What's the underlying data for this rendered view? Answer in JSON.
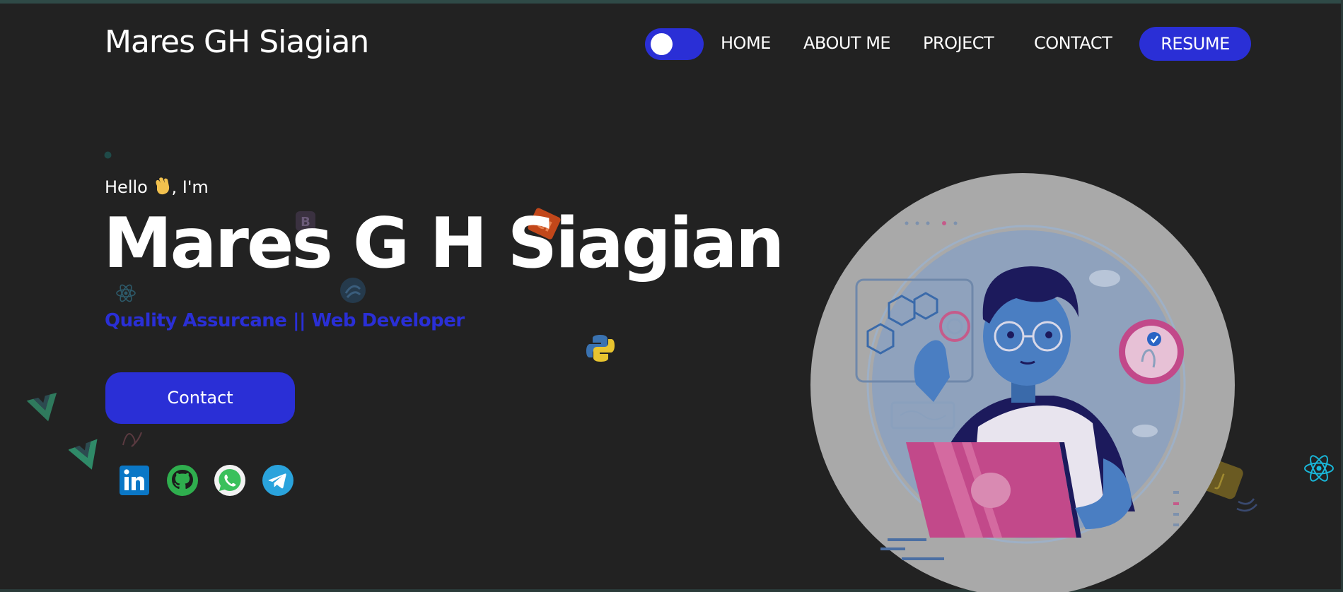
{
  "header": {
    "logo": "Mares GH Siagian",
    "nav": [
      "HOME",
      "ABOUT ME",
      "PROJECT",
      "CONTACT"
    ],
    "resume_label": "RESUME",
    "theme_toggle": "on"
  },
  "hero": {
    "greeting_before": "Hello",
    "greeting_after": ", I'm",
    "name": "Mares G H Siagian",
    "subtitle": "Quality Assurcane || Web Developer",
    "contact_label": "Contact"
  },
  "social": [
    "linkedin-icon",
    "github-icon",
    "whatsapp-icon",
    "telegram-icon"
  ],
  "colors": {
    "background": "#222222",
    "accent": "#2a2fd6",
    "text": "#ffffff",
    "illustration_circle": "#a9a9a9"
  }
}
